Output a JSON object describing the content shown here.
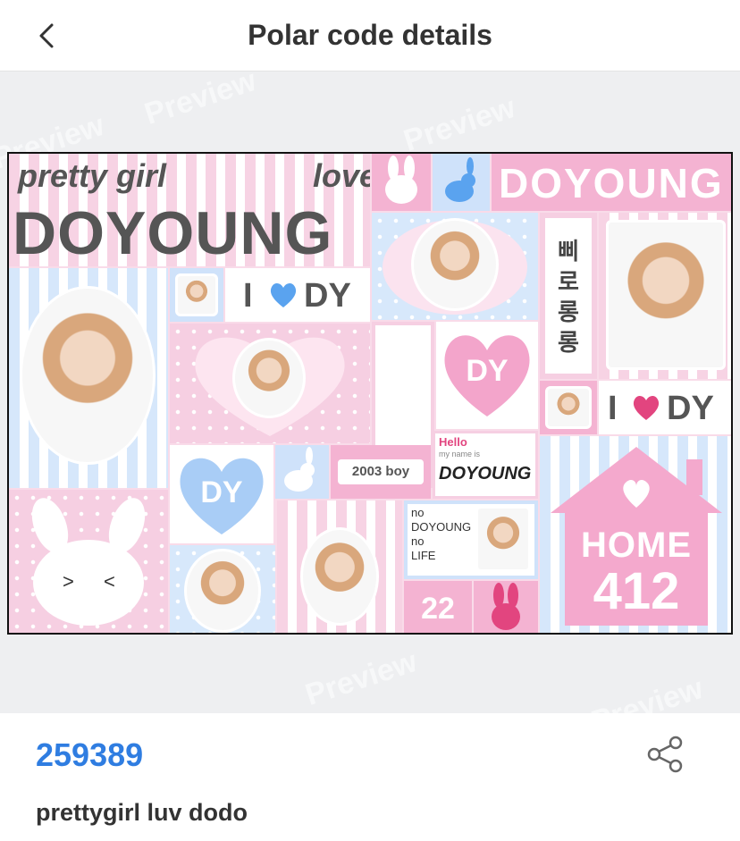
{
  "header": {
    "title": "Polar code details",
    "back_icon": "chevron-left-icon"
  },
  "preview": {
    "watermark": "Preview",
    "card": {
      "pretty_girl": "pretty girl",
      "love": "love",
      "name_big": "DOYOUNG",
      "name_outline": "DOYOUNG",
      "i_label": "I",
      "dy": "DY",
      "i_label_2": "I",
      "dy_2": "DY",
      "heart_dy": "DY",
      "blue_heart_dy": "DY",
      "korean_vertical": "삐로롱롱",
      "boy_tag": "2003 boy",
      "hello": "Hello",
      "hello_small": "my name is",
      "hello_name": "DOYOUNG",
      "no_1": "no",
      "no_doyoung": "DOYOUNG",
      "no_2": "no",
      "life": "LIFE",
      "number_22": "22",
      "home": "HOME",
      "home_num": "412"
    }
  },
  "footer": {
    "code": "259389",
    "description": "prettygirl luv dodo",
    "share_icon": "share-icon"
  },
  "colors": {
    "accent_blue": "#2f7de1",
    "pink": "#f4b3d2",
    "light_blue": "#cfe2fa"
  }
}
